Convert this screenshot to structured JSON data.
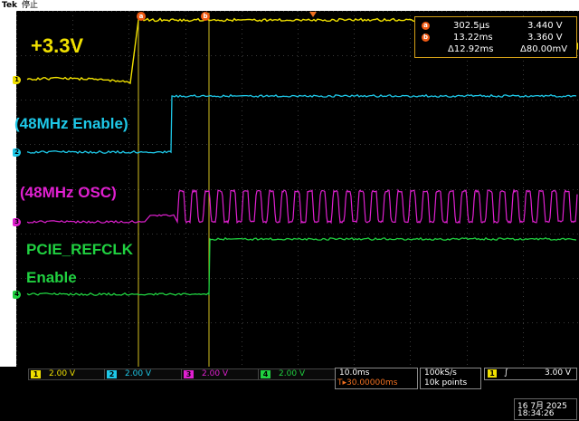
{
  "header": {
    "brand": "Tek",
    "acq_state": "停止"
  },
  "annotations": {
    "v33": "+3.3V",
    "mhz48_enable": "(48MHz Enable)",
    "mhz48_osc": "(48MHz OSC)",
    "pcie_line1": "PCIE_REFCLK",
    "pcie_line2": "Enable"
  },
  "cursor_readout": {
    "a_label": "a",
    "a_time": "302.5µs",
    "a_volt": "3.440 V",
    "b_label": "b",
    "b_time": "13.22ms",
    "b_volt": "3.360 V",
    "delta_time": "Δ12.92ms",
    "delta_volt": "Δ80.00mV"
  },
  "cursor_markers": {
    "a": "a",
    "b": "b"
  },
  "channels": [
    {
      "num": "1",
      "scale": "2.00 V",
      "color": "#f0e000",
      "marker": "1"
    },
    {
      "num": "2",
      "scale": "2.00 V",
      "color": "#1ec8e8",
      "marker": "2"
    },
    {
      "num": "3",
      "scale": "2.00 V",
      "color": "#e020d0",
      "marker": "3"
    },
    {
      "num": "4",
      "scale": "2.00 V",
      "color": "#20d040",
      "marker": "4"
    }
  ],
  "timebase": {
    "scale": "10.0ms",
    "trigger_pos": "T▸30.00000ms"
  },
  "sampling": {
    "rate": "100kS/s",
    "points": "10k points"
  },
  "trigger": {
    "channel": "1",
    "slope": "∫",
    "level": "3.00 V"
  },
  "clock": {
    "date": "16 7月  2025",
    "time": "18:34:26"
  },
  "colors": {
    "ch1": "#f0e000",
    "ch2": "#1ec8e8",
    "ch3": "#e020d0",
    "ch4": "#20d040",
    "cursor": "#d4c020",
    "readout_border": "#d4a017"
  }
}
